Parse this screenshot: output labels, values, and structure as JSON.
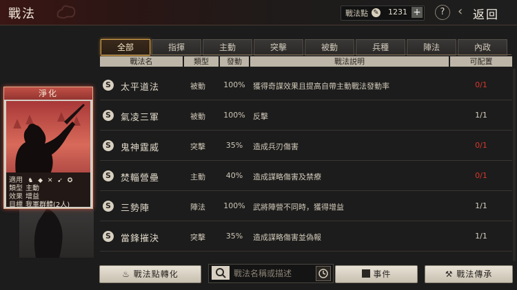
{
  "header": {
    "title": "戰法",
    "points_label": "戰法點",
    "points_value": "1231",
    "add_symbol": "+",
    "help_symbol": "?",
    "back_label": "返回"
  },
  "tabs": [
    "全部",
    "指揮",
    "主動",
    "突擊",
    "被動",
    "兵種",
    "陣法",
    "內政"
  ],
  "columns": {
    "name": "戰法名",
    "type": "類型",
    "rate": "發動",
    "desc": "戰法説明",
    "config": "可配置"
  },
  "rows": [
    {
      "icon": "S",
      "name": "太平道法",
      "type": "被動",
      "rate": "100%",
      "desc": "獲得奇謀效果且提高自帶主動戰法發動率",
      "config": "0/1",
      "config_color": "#d8382c"
    },
    {
      "icon": "S",
      "name": "氣凌三軍",
      "type": "被動",
      "rate": "100%",
      "desc": "反擊",
      "config": "1/1",
      "config_color": "#d8d0c0"
    },
    {
      "icon": "S",
      "name": "鬼神霆威",
      "type": "突擊",
      "rate": "35%",
      "desc": "造成兵刃傷害",
      "config": "0/1",
      "config_color": "#d8382c"
    },
    {
      "icon": "S",
      "name": "焚輜營壘",
      "type": "主動",
      "rate": "40%",
      "desc": "造成謀略傷害及禁療",
      "config": "0/1",
      "config_color": "#d8382c"
    },
    {
      "icon": "S",
      "name": "三勢陣",
      "type": "陣法",
      "rate": "100%",
      "desc": "武將陣營不同時，獲得增益",
      "config": "1/1",
      "config_color": "#d8d0c0"
    },
    {
      "icon": "S",
      "name": "當鋒摧決",
      "type": "突擊",
      "rate": "35%",
      "desc": "造成謀略傷害並偽報",
      "config": "1/1",
      "config_color": "#d8d0c0"
    }
  ],
  "card": {
    "title": "淨化",
    "applies_label": "適用",
    "type_label": "類型",
    "type_value": "主動",
    "effect_label": "效果",
    "effect_value": "增益",
    "target_label": "目標",
    "target_value": "我軍群體(2人)"
  },
  "bottom": {
    "convert_label": "戰法點轉化",
    "search_placeholder": "戰法名稱或描述",
    "events_label": "事件",
    "inherit_label": "戰法傳承"
  }
}
